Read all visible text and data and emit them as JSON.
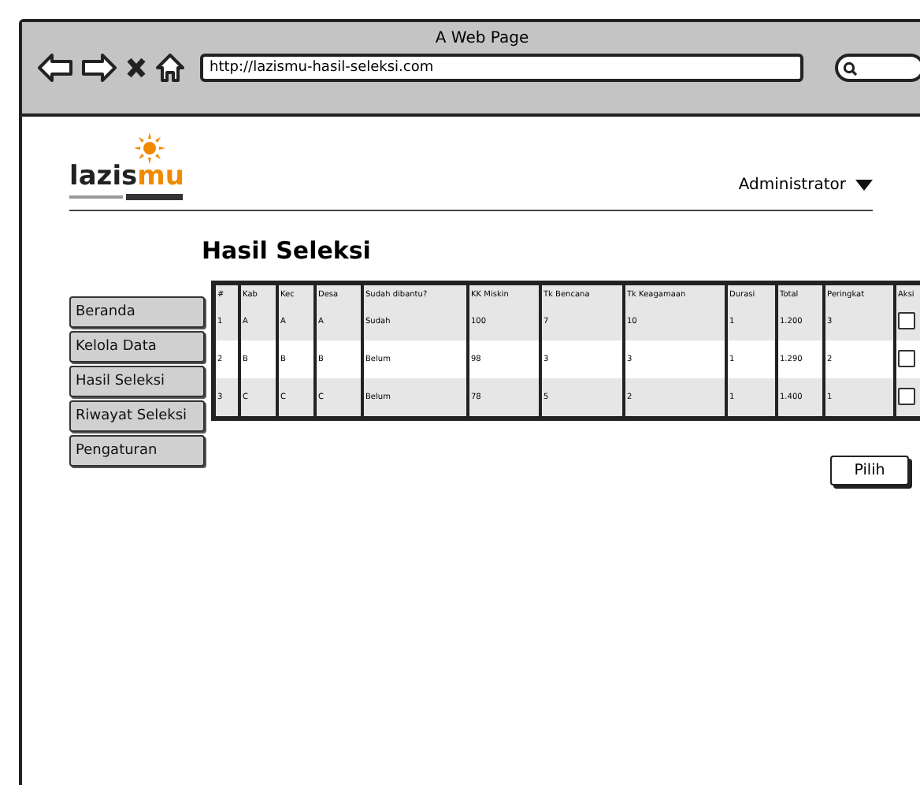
{
  "window": {
    "title": "A Web Page",
    "url": "http://lazismu-hasil-seleksi.com"
  },
  "logo": {
    "text": "lazis",
    "accent": "mu"
  },
  "user_menu": {
    "label": "Administrator"
  },
  "heading": "Hasil Seleksi",
  "sidebar": {
    "items": [
      {
        "label": "Beranda",
        "selected": false
      },
      {
        "label": "Kelola Data",
        "selected": false
      },
      {
        "label": "Hasil Seleksi",
        "selected": false
      },
      {
        "label": "Riwayat Seleksi",
        "selected": false
      },
      {
        "label": "Pengaturan",
        "selected": false
      }
    ]
  },
  "table": {
    "columns": [
      "#",
      "Kab",
      "Kec",
      "Desa",
      "Sudah dibantu?",
      "KK Miskin",
      "Tk Bencana",
      "Tk Keagamaan",
      "Durasi",
      "Total",
      "Peringkat",
      "Aksi"
    ],
    "rows": [
      {
        "cells": [
          "1",
          "A",
          "A",
          "A",
          "Sudah",
          "100",
          "7",
          "10",
          "1",
          "1.200",
          "3"
        ],
        "checked": false
      },
      {
        "cells": [
          "2",
          "B",
          "B",
          "B",
          "Belum",
          "98",
          "3",
          "3",
          "1",
          "1.290",
          "2"
        ],
        "checked": false
      },
      {
        "cells": [
          "3",
          "C",
          "C",
          "C",
          "Belum",
          "78",
          "5",
          "2",
          "1",
          "1.400",
          "1"
        ],
        "checked": false
      }
    ]
  },
  "button": "Pilih"
}
